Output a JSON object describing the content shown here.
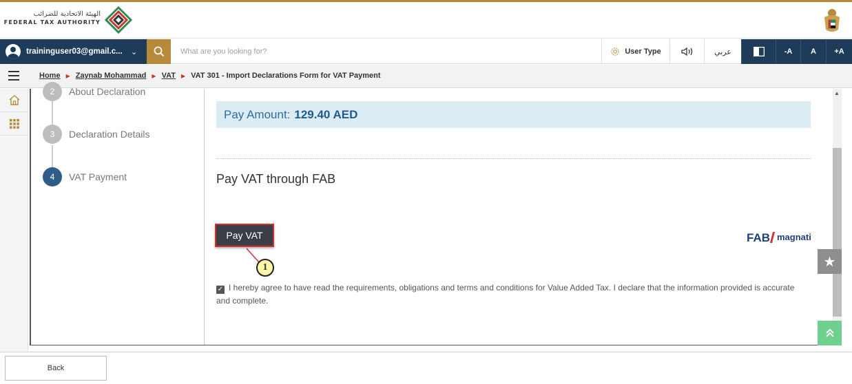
{
  "header": {
    "logo_ar": "الهيئة الاتحادية للضرائب",
    "logo_en": "FEDERAL TAX AUTHORITY"
  },
  "toolbar": {
    "user_email": "traininguser03@gmail.c...",
    "search_placeholder": "What are you looking for?",
    "user_type_label": "User Type",
    "arabic_label": "عربي",
    "font_decrease": "-A",
    "font_normal": "A",
    "font_increase": "+A"
  },
  "breadcrumb": {
    "items": [
      "Home",
      "Zaynab Mohammad",
      "VAT"
    ],
    "current": "VAT 301 - Import Declarations Form for VAT Payment"
  },
  "steps": [
    {
      "number": "2",
      "label": "About Declaration",
      "active": false
    },
    {
      "number": "3",
      "label": "Declaration Details",
      "active": false
    },
    {
      "number": "4",
      "label": "VAT Payment",
      "active": true
    }
  ],
  "payment": {
    "amount_label": "Pay Amount:",
    "amount_value": "129.40 AED",
    "title": "Pay VAT through FAB",
    "pay_button": "Pay VAT",
    "callout_number": "1",
    "agreement_text": "I hereby agree to have read the requirements, obligations and terms and conditions for Value Added Tax. I declare that the information provided is accurate and complete.",
    "agreement_checked": true,
    "partner_logo_text_1": "FAB",
    "partner_logo_text_2": "magnati"
  },
  "footer": {
    "back_label": "Back"
  },
  "colors": {
    "gold": "#b6893b",
    "navy": "#1f3b5a",
    "step_active": "#2f5d8a",
    "pay_amount_bg": "#dcecf5",
    "callout_highlight": "#d32f2f"
  }
}
